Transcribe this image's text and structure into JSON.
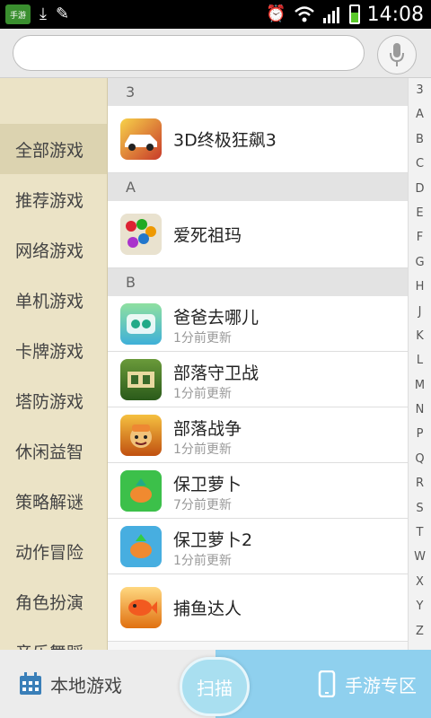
{
  "status_bar": {
    "app_badge": "手游",
    "time": "14:08",
    "battery_level": 0.6
  },
  "search": {
    "value": "",
    "placeholder": ""
  },
  "sidebar": {
    "items": [
      {
        "label": "全部游戏",
        "active": true
      },
      {
        "label": "推荐游戏"
      },
      {
        "label": "网络游戏"
      },
      {
        "label": "单机游戏"
      },
      {
        "label": "卡牌游戏"
      },
      {
        "label": "塔防游戏"
      },
      {
        "label": "休闲益智"
      },
      {
        "label": "策略解谜"
      },
      {
        "label": "动作冒险"
      },
      {
        "label": "角色扮演"
      },
      {
        "label": "音乐舞蹈"
      }
    ]
  },
  "list": {
    "sections": [
      {
        "header": "3",
        "items": [
          {
            "name": "3D终极狂飙3",
            "icon": "racing-car-icon",
            "color": "#c83a2a"
          }
        ]
      },
      {
        "header": "A",
        "items": [
          {
            "name": "爱死祖玛",
            "icon": "zuma-marbles-icon",
            "color": "#6a4a2a"
          }
        ]
      },
      {
        "header": "B",
        "items": [
          {
            "name": "爸爸去哪儿",
            "sub": "1分前更新",
            "icon": "father-where-icon",
            "color": "#3fb0d8"
          },
          {
            "name": "部落守卫战",
            "sub": "1分前更新",
            "icon": "tribe-guard-icon",
            "color": "#3a7a2a"
          },
          {
            "name": "部落战争",
            "sub": "1分前更新",
            "icon": "clash-clans-icon",
            "color": "#d08020"
          },
          {
            "name": "保卫萝卜",
            "sub": "7分前更新",
            "icon": "carrot-icon",
            "color": "#2fb040"
          },
          {
            "name": "保卫萝卜2",
            "sub": "1分前更新",
            "icon": "carrot2-icon",
            "color": "#2a9ad0"
          },
          {
            "name": "捕鱼达人",
            "icon": "fishing-icon",
            "color": "#e07010"
          }
        ]
      }
    ]
  },
  "index_letters": [
    "3",
    "A",
    "B",
    "C",
    "D",
    "E",
    "F",
    "G",
    "H",
    "J",
    "K",
    "L",
    "M",
    "N",
    "P",
    "Q",
    "R",
    "S",
    "T",
    "W",
    "X",
    "Y",
    "Z"
  ],
  "bottom": {
    "local_label": "本地游戏",
    "scan_label": "扫描",
    "zone_label": "手游专区"
  }
}
